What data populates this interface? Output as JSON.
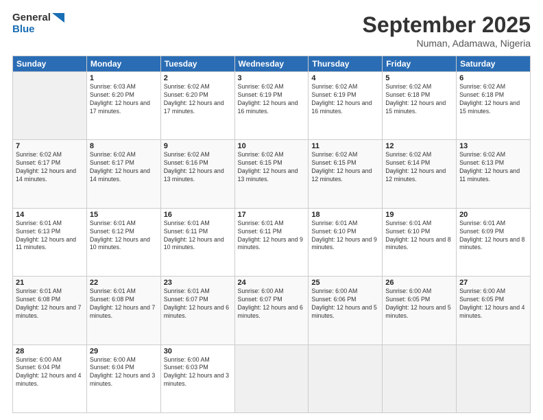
{
  "logo": {
    "line1": "General",
    "line2": "Blue"
  },
  "header": {
    "title": "September 2025",
    "subtitle": "Numan, Adamawa, Nigeria"
  },
  "weekdays": [
    "Sunday",
    "Monday",
    "Tuesday",
    "Wednesday",
    "Thursday",
    "Friday",
    "Saturday"
  ],
  "weeks": [
    [
      {
        "day": "",
        "sunrise": "",
        "sunset": "",
        "daylight": ""
      },
      {
        "day": "1",
        "sunrise": "Sunrise: 6:03 AM",
        "sunset": "Sunset: 6:20 PM",
        "daylight": "Daylight: 12 hours and 17 minutes."
      },
      {
        "day": "2",
        "sunrise": "Sunrise: 6:02 AM",
        "sunset": "Sunset: 6:20 PM",
        "daylight": "Daylight: 12 hours and 17 minutes."
      },
      {
        "day": "3",
        "sunrise": "Sunrise: 6:02 AM",
        "sunset": "Sunset: 6:19 PM",
        "daylight": "Daylight: 12 hours and 16 minutes."
      },
      {
        "day": "4",
        "sunrise": "Sunrise: 6:02 AM",
        "sunset": "Sunset: 6:19 PM",
        "daylight": "Daylight: 12 hours and 16 minutes."
      },
      {
        "day": "5",
        "sunrise": "Sunrise: 6:02 AM",
        "sunset": "Sunset: 6:18 PM",
        "daylight": "Daylight: 12 hours and 15 minutes."
      },
      {
        "day": "6",
        "sunrise": "Sunrise: 6:02 AM",
        "sunset": "Sunset: 6:18 PM",
        "daylight": "Daylight: 12 hours and 15 minutes."
      }
    ],
    [
      {
        "day": "7",
        "sunrise": "Sunrise: 6:02 AM",
        "sunset": "Sunset: 6:17 PM",
        "daylight": "Daylight: 12 hours and 14 minutes."
      },
      {
        "day": "8",
        "sunrise": "Sunrise: 6:02 AM",
        "sunset": "Sunset: 6:17 PM",
        "daylight": "Daylight: 12 hours and 14 minutes."
      },
      {
        "day": "9",
        "sunrise": "Sunrise: 6:02 AM",
        "sunset": "Sunset: 6:16 PM",
        "daylight": "Daylight: 12 hours and 13 minutes."
      },
      {
        "day": "10",
        "sunrise": "Sunrise: 6:02 AM",
        "sunset": "Sunset: 6:15 PM",
        "daylight": "Daylight: 12 hours and 13 minutes."
      },
      {
        "day": "11",
        "sunrise": "Sunrise: 6:02 AM",
        "sunset": "Sunset: 6:15 PM",
        "daylight": "Daylight: 12 hours and 12 minutes."
      },
      {
        "day": "12",
        "sunrise": "Sunrise: 6:02 AM",
        "sunset": "Sunset: 6:14 PM",
        "daylight": "Daylight: 12 hours and 12 minutes."
      },
      {
        "day": "13",
        "sunrise": "Sunrise: 6:02 AM",
        "sunset": "Sunset: 6:13 PM",
        "daylight": "Daylight: 12 hours and 11 minutes."
      }
    ],
    [
      {
        "day": "14",
        "sunrise": "Sunrise: 6:01 AM",
        "sunset": "Sunset: 6:13 PM",
        "daylight": "Daylight: 12 hours and 11 minutes."
      },
      {
        "day": "15",
        "sunrise": "Sunrise: 6:01 AM",
        "sunset": "Sunset: 6:12 PM",
        "daylight": "Daylight: 12 hours and 10 minutes."
      },
      {
        "day": "16",
        "sunrise": "Sunrise: 6:01 AM",
        "sunset": "Sunset: 6:11 PM",
        "daylight": "Daylight: 12 hours and 10 minutes."
      },
      {
        "day": "17",
        "sunrise": "Sunrise: 6:01 AM",
        "sunset": "Sunset: 6:11 PM",
        "daylight": "Daylight: 12 hours and 9 minutes."
      },
      {
        "day": "18",
        "sunrise": "Sunrise: 6:01 AM",
        "sunset": "Sunset: 6:10 PM",
        "daylight": "Daylight: 12 hours and 9 minutes."
      },
      {
        "day": "19",
        "sunrise": "Sunrise: 6:01 AM",
        "sunset": "Sunset: 6:10 PM",
        "daylight": "Daylight: 12 hours and 8 minutes."
      },
      {
        "day": "20",
        "sunrise": "Sunrise: 6:01 AM",
        "sunset": "Sunset: 6:09 PM",
        "daylight": "Daylight: 12 hours and 8 minutes."
      }
    ],
    [
      {
        "day": "21",
        "sunrise": "Sunrise: 6:01 AM",
        "sunset": "Sunset: 6:08 PM",
        "daylight": "Daylight: 12 hours and 7 minutes."
      },
      {
        "day": "22",
        "sunrise": "Sunrise: 6:01 AM",
        "sunset": "Sunset: 6:08 PM",
        "daylight": "Daylight: 12 hours and 7 minutes."
      },
      {
        "day": "23",
        "sunrise": "Sunrise: 6:01 AM",
        "sunset": "Sunset: 6:07 PM",
        "daylight": "Daylight: 12 hours and 6 minutes."
      },
      {
        "day": "24",
        "sunrise": "Sunrise: 6:00 AM",
        "sunset": "Sunset: 6:07 PM",
        "daylight": "Daylight: 12 hours and 6 minutes."
      },
      {
        "day": "25",
        "sunrise": "Sunrise: 6:00 AM",
        "sunset": "Sunset: 6:06 PM",
        "daylight": "Daylight: 12 hours and 5 minutes."
      },
      {
        "day": "26",
        "sunrise": "Sunrise: 6:00 AM",
        "sunset": "Sunset: 6:05 PM",
        "daylight": "Daylight: 12 hours and 5 minutes."
      },
      {
        "day": "27",
        "sunrise": "Sunrise: 6:00 AM",
        "sunset": "Sunset: 6:05 PM",
        "daylight": "Daylight: 12 hours and 4 minutes."
      }
    ],
    [
      {
        "day": "28",
        "sunrise": "Sunrise: 6:00 AM",
        "sunset": "Sunset: 6:04 PM",
        "daylight": "Daylight: 12 hours and 4 minutes."
      },
      {
        "day": "29",
        "sunrise": "Sunrise: 6:00 AM",
        "sunset": "Sunset: 6:04 PM",
        "daylight": "Daylight: 12 hours and 3 minutes."
      },
      {
        "day": "30",
        "sunrise": "Sunrise: 6:00 AM",
        "sunset": "Sunset: 6:03 PM",
        "daylight": "Daylight: 12 hours and 3 minutes."
      },
      {
        "day": "",
        "sunrise": "",
        "sunset": "",
        "daylight": ""
      },
      {
        "day": "",
        "sunrise": "",
        "sunset": "",
        "daylight": ""
      },
      {
        "day": "",
        "sunrise": "",
        "sunset": "",
        "daylight": ""
      },
      {
        "day": "",
        "sunrise": "",
        "sunset": "",
        "daylight": ""
      }
    ]
  ]
}
